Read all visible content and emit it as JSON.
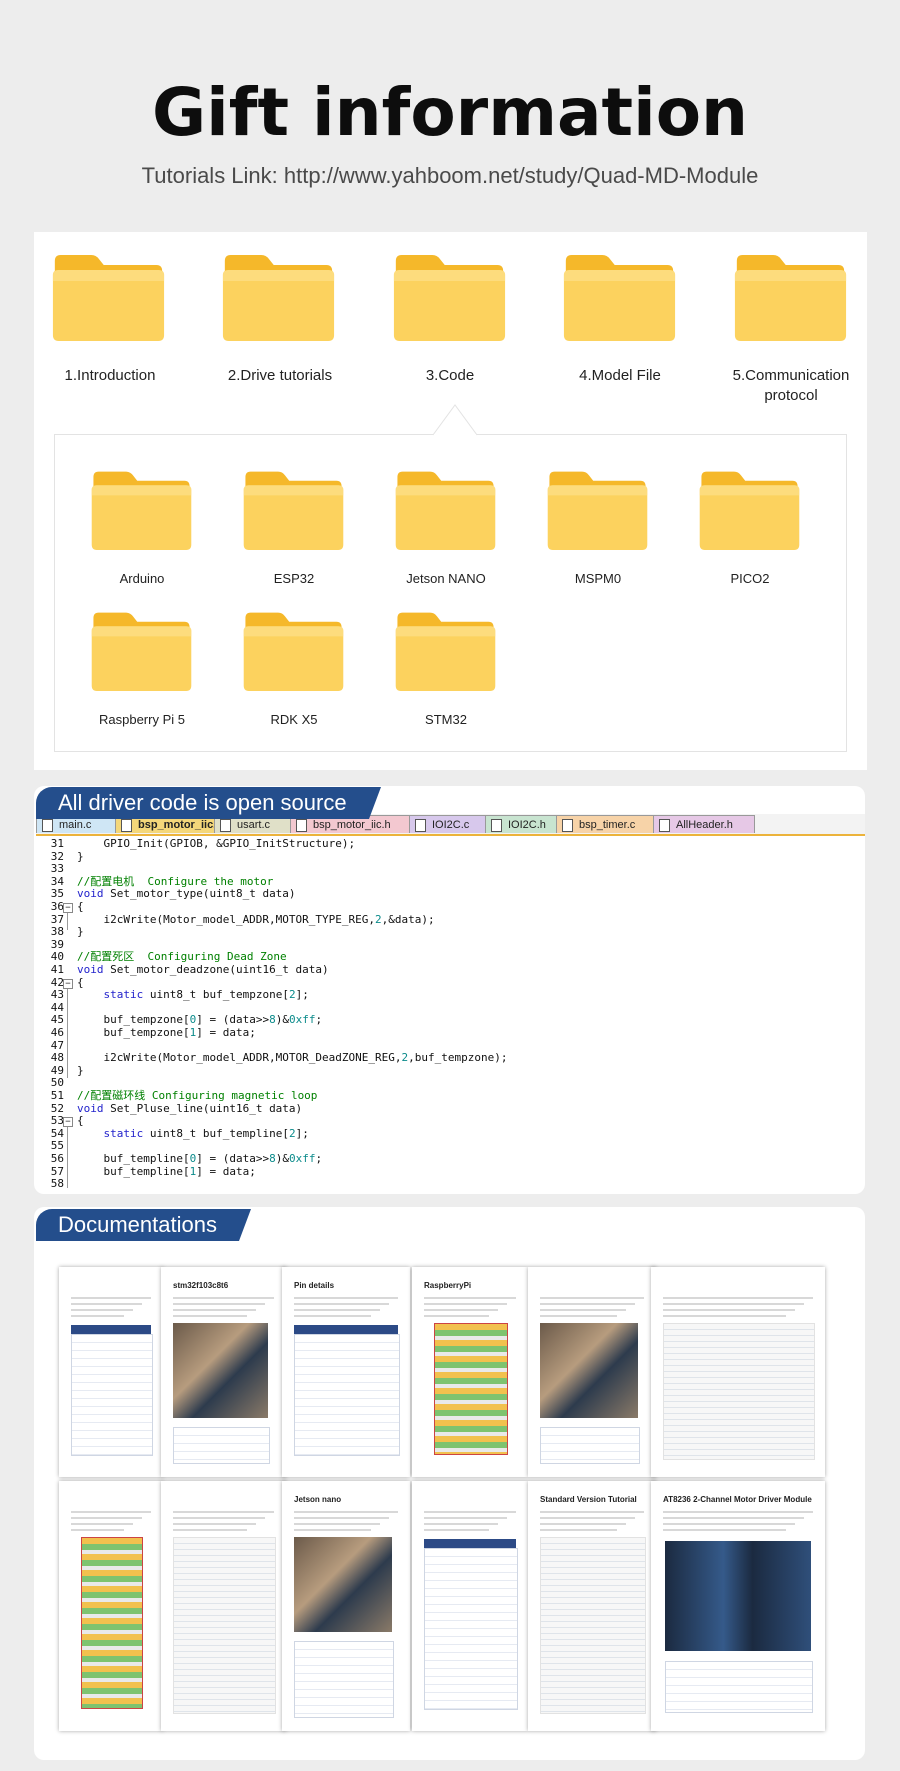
{
  "header": {
    "title": "Gift information",
    "subtitle": "Tutorials Link: http://www.yahboom.net/study/Quad-MD-Module"
  },
  "top_folders": [
    {
      "label": "1.Introduction"
    },
    {
      "label": "2.Drive tutorials"
    },
    {
      "label": "3.Code"
    },
    {
      "label": "4.Model File"
    },
    {
      "label": "5.Communication protocol"
    }
  ],
  "sub_folders": [
    {
      "label": "Arduino"
    },
    {
      "label": "ESP32"
    },
    {
      "label": "Jetson NANO"
    },
    {
      "label": "MSPM0"
    },
    {
      "label": "PICO2"
    },
    {
      "label": "Raspberry Pi 5"
    },
    {
      "label": "RDK X5"
    },
    {
      "label": "STM32"
    }
  ],
  "code_section": {
    "tag": "All driver code is open source",
    "tabs": [
      {
        "label": "main.c",
        "color": "#cfe6f5"
      },
      {
        "label": "bsp_motor_iic.c",
        "color": "#f4d77a"
      },
      {
        "label": "usart.c",
        "color": "#e0e0c8"
      },
      {
        "label": "bsp_motor_iic.h",
        "color": "#f3c8d0"
      },
      {
        "label": "IOI2C.c",
        "color": "#d7c8ec"
      },
      {
        "label": "IOI2C.h",
        "color": "#c8e4d0"
      },
      {
        "label": "bsp_timer.c",
        "color": "#f7d3a8"
      },
      {
        "label": "AllHeader.h",
        "color": "#e6c8e6"
      }
    ],
    "lines": [
      {
        "n": "31",
        "t": "    GPIO_Init(GPIOB, &GPIO_InitStructure);"
      },
      {
        "n": "32",
        "t": "}"
      },
      {
        "n": "33",
        "t": ""
      },
      {
        "n": "34",
        "t": "//配置电机  Configure the motor"
      },
      {
        "n": "35",
        "t": "void Set_motor_type(uint8_t data)"
      },
      {
        "n": "36",
        "t": "{"
      },
      {
        "n": "37",
        "t": "    i2cWrite(Motor_model_ADDR,MOTOR_TYPE_REG,2,&data);"
      },
      {
        "n": "38",
        "t": "}"
      },
      {
        "n": "39",
        "t": ""
      },
      {
        "n": "40",
        "t": "//配置死区  Configuring Dead Zone"
      },
      {
        "n": "41",
        "t": "void Set_motor_deadzone(uint16_t data)"
      },
      {
        "n": "42",
        "t": "{"
      },
      {
        "n": "43",
        "t": "    static uint8_t buf_tempzone[2];"
      },
      {
        "n": "44",
        "t": ""
      },
      {
        "n": "45",
        "t": "    buf_tempzone[0] = (data>>8)&0xff;"
      },
      {
        "n": "46",
        "t": "    buf_tempzone[1] = data;"
      },
      {
        "n": "47",
        "t": ""
      },
      {
        "n": "48",
        "t": "    i2cWrite(Motor_model_ADDR,MOTOR_DeadZONE_REG,2,buf_tempzone);"
      },
      {
        "n": "49",
        "t": "}"
      },
      {
        "n": "50",
        "t": ""
      },
      {
        "n": "51",
        "t": "//配置磁环线 Configuring magnetic loop"
      },
      {
        "n": "52",
        "t": "void Set_Pluse_line(uint16_t data)"
      },
      {
        "n": "53",
        "t": "{"
      },
      {
        "n": "54",
        "t": "    static uint8_t buf_templine[2];"
      },
      {
        "n": "55",
        "t": ""
      },
      {
        "n": "56",
        "t": "    buf_templine[0] = (data>>8)&0xff;"
      },
      {
        "n": "57",
        "t": "    buf_templine[1] = data;"
      },
      {
        "n": "58",
        "t": ""
      }
    ]
  },
  "docs_section": {
    "tag": "Documentations",
    "doc_titles": [
      {
        "label": ""
      },
      {
        "label": "stm32f103c8t6"
      },
      {
        "label": "Pin details"
      },
      {
        "label": "RaspberryPi"
      },
      {
        "label": ""
      },
      {
        "label": ""
      },
      {
        "label": ""
      },
      {
        "label": ""
      },
      {
        "label": "Jetson nano"
      },
      {
        "label": ""
      },
      {
        "label": "Standard Version Tutorial"
      },
      {
        "label": "AT8236 2-Channel Motor Driver Module"
      }
    ]
  },
  "colors": {
    "folder_front": "#fcd25e",
    "folder_back": "#f5b82a",
    "tag_bg": "#244e8c",
    "page_bg": "#ededed"
  },
  "icons": [
    "folder-icon",
    "file-tab-icon",
    "fold-marker-icon"
  ]
}
